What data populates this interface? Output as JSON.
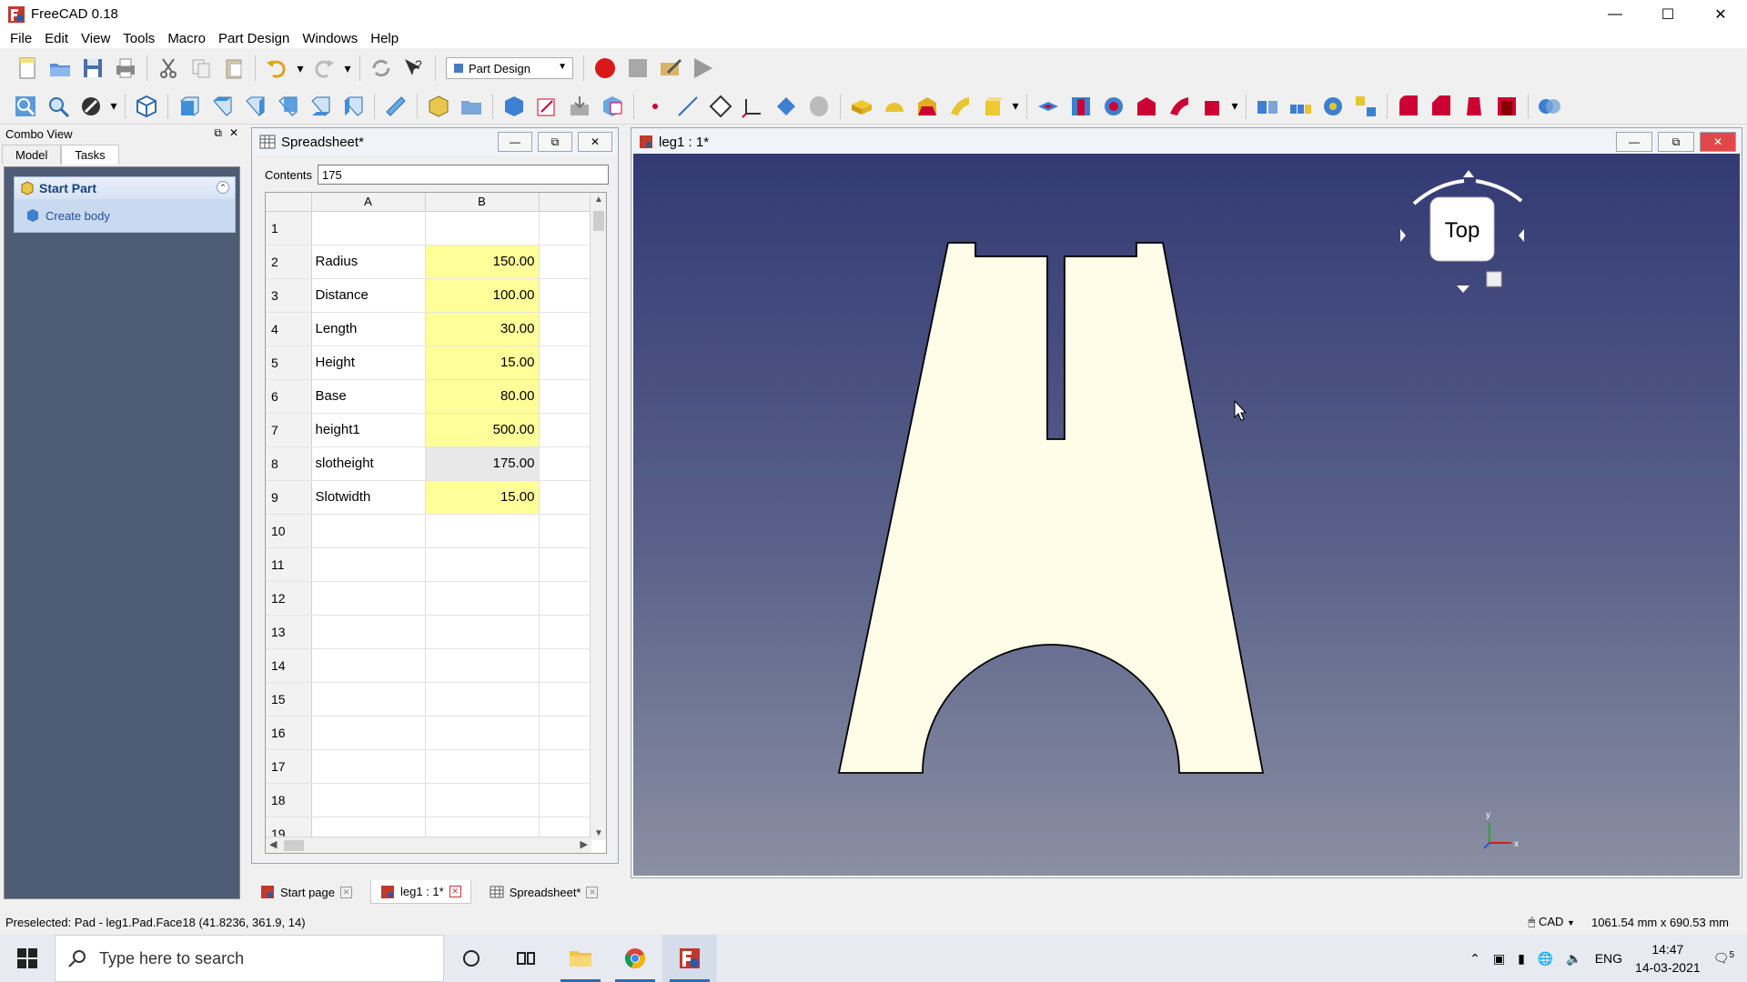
{
  "window": {
    "title": "FreeCAD 0.18"
  },
  "menu": [
    "File",
    "Edit",
    "View",
    "Tools",
    "Macro",
    "Part Design",
    "Windows",
    "Help"
  ],
  "toolbar": {
    "workbench": "Part Design"
  },
  "combo_view": {
    "title": "Combo View",
    "tabs": [
      "Model",
      "Tasks"
    ],
    "task_panel": {
      "header": "Start Part",
      "item": "Create body"
    }
  },
  "spreadsheet": {
    "title": "Spreadsheet*",
    "contents_label": "Contents",
    "contents_value": "175",
    "columns": [
      "A",
      "B"
    ],
    "rows": [
      {
        "n": "1",
        "a": "",
        "b": "",
        "hl": false,
        "sel": false
      },
      {
        "n": "2",
        "a": "Radius",
        "b": "150.00",
        "hl": true,
        "sel": false
      },
      {
        "n": "3",
        "a": "Distance",
        "b": "100.00",
        "hl": true,
        "sel": false
      },
      {
        "n": "4",
        "a": "Length",
        "b": "30.00",
        "hl": true,
        "sel": false
      },
      {
        "n": "5",
        "a": "Height",
        "b": "15.00",
        "hl": true,
        "sel": false
      },
      {
        "n": "6",
        "a": "Base",
        "b": "80.00",
        "hl": true,
        "sel": false
      },
      {
        "n": "7",
        "a": "height1",
        "b": "500.00",
        "hl": true,
        "sel": false
      },
      {
        "n": "8",
        "a": "slotheight",
        "b": "175.00",
        "hl": false,
        "sel": true
      },
      {
        "n": "9",
        "a": "Slotwidth",
        "b": "15.00",
        "hl": true,
        "sel": false
      },
      {
        "n": "10",
        "a": "",
        "b": "",
        "hl": false,
        "sel": false
      },
      {
        "n": "11",
        "a": "",
        "b": "",
        "hl": false,
        "sel": false
      },
      {
        "n": "12",
        "a": "",
        "b": "",
        "hl": false,
        "sel": false
      },
      {
        "n": "13",
        "a": "",
        "b": "",
        "hl": false,
        "sel": false
      },
      {
        "n": "14",
        "a": "",
        "b": "",
        "hl": false,
        "sel": false
      },
      {
        "n": "15",
        "a": "",
        "b": "",
        "hl": false,
        "sel": false
      },
      {
        "n": "16",
        "a": "",
        "b": "",
        "hl": false,
        "sel": false
      },
      {
        "n": "17",
        "a": "",
        "b": "",
        "hl": false,
        "sel": false
      },
      {
        "n": "18",
        "a": "",
        "b": "",
        "hl": false,
        "sel": false
      },
      {
        "n": "19",
        "a": "",
        "b": "",
        "hl": false,
        "sel": false
      }
    ]
  },
  "view3d": {
    "title": "leg1 : 1*",
    "navcube_face": "Top",
    "axis_x": "x",
    "axis_y": "y"
  },
  "doc_tabs": [
    {
      "label": "Start page",
      "active": false
    },
    {
      "label": "leg1 : 1*",
      "active": true
    },
    {
      "label": "Spreadsheet*",
      "active": false
    }
  ],
  "status": {
    "preselected": "Preselected: Pad - leg1.Pad.Face18 (41.8236, 361.9, 14)",
    "nav_style": "CAD",
    "dimensions": "1061.54 mm x 690.53 mm"
  },
  "taskbar": {
    "search_placeholder": "Type here to search",
    "lang": "ENG",
    "time": "14:47",
    "date": "14-03-2021",
    "notif_count": "5"
  },
  "colors": {
    "highlight": "#ffff99",
    "part_fill": "#fffde8",
    "view_bg_top": "#333a74",
    "view_bg_bottom": "#8a8fa2"
  }
}
